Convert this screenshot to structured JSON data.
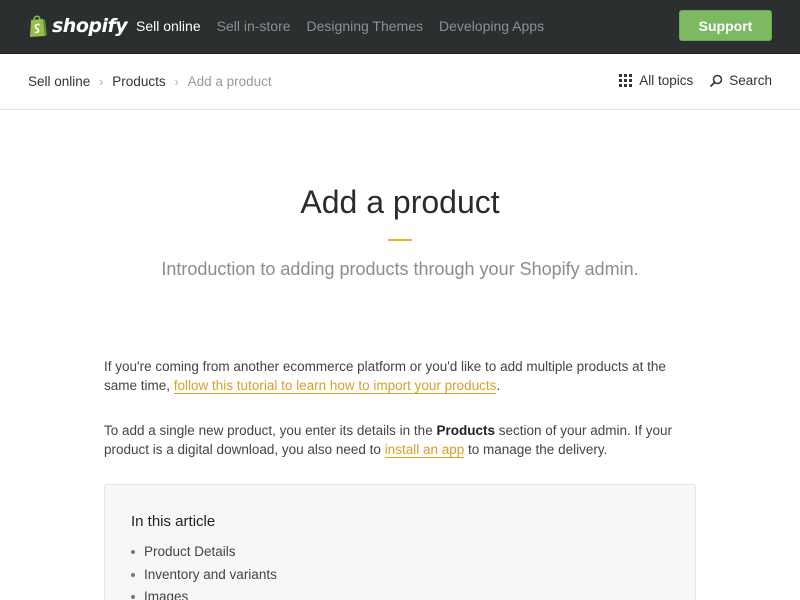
{
  "topnav": {
    "logo_text": "shopify",
    "links": [
      {
        "label": "Sell online",
        "active": true
      },
      {
        "label": "Sell in-store",
        "active": false
      },
      {
        "label": "Designing Themes",
        "active": false
      },
      {
        "label": "Developing Apps",
        "active": false
      }
    ],
    "support_label": "Support"
  },
  "breadcrumb": {
    "items": [
      "Sell online",
      "Products",
      "Add a product"
    ]
  },
  "subnav": {
    "topics_label": "All topics",
    "search_label": "Search"
  },
  "page": {
    "title": "Add a product",
    "subtitle": "Introduction to adding products through your Shopify admin."
  },
  "body": {
    "p1_text": "If you're coming from another ecommerce platform or you'd like to add multiple products at the same time, ",
    "p1_link": "follow this tutorial to learn how to import your products",
    "p1_end": ".",
    "p2_a": "To add a single new product, you enter its details in the ",
    "p2_bold": "Products",
    "p2_b": " section of your admin. If your product is a digital download, you also need to ",
    "p2_link": "install an app",
    "p2_c": " to manage the delivery."
  },
  "toc": {
    "title": "In this article",
    "items": [
      "Product Details",
      "Inventory and variants",
      "Images"
    ]
  },
  "colors": {
    "nav_bg": "#2b2f30",
    "support_green": "#7cb960",
    "link_gold": "#d4a12b",
    "accent_rule": "#e5b22e"
  }
}
